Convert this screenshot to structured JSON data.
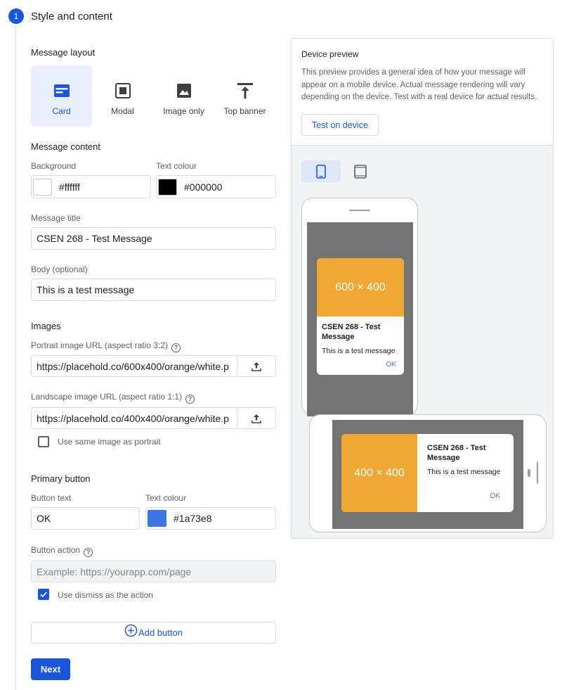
{
  "step": {
    "number": "1",
    "title": "Style and content"
  },
  "message_layout": {
    "label": "Message layout",
    "options": [
      {
        "label": "Card",
        "icon": "card-layout-icon",
        "selected": true
      },
      {
        "label": "Modal",
        "icon": "modal-layout-icon",
        "selected": false
      },
      {
        "label": "Image only",
        "icon": "image-icon",
        "selected": false
      },
      {
        "label": "Top banner",
        "icon": "top-banner-icon",
        "selected": false
      }
    ]
  },
  "message_content": {
    "label": "Message content",
    "background_label": "Background",
    "background_value": "#ffffff",
    "background_swatch": "#ffffff",
    "text_colour_label": "Text colour",
    "text_colour_value": "#000000",
    "text_colour_swatch": "#000000",
    "title_label": "Message title",
    "title_value": "CSEN 268 - Test Message",
    "body_label": "Body (optional)",
    "body_value": "This is a test message"
  },
  "images": {
    "label": "Images",
    "portrait_label": "Portrait image URL (aspect ratio 3:2)",
    "portrait_value": "https://placehold.co/600x400/orange/white.p",
    "landscape_label": "Landscape image URL (aspect ratio 1:1)",
    "landscape_value": "https://placehold.co/400x400/orange/white.p",
    "same_as_portrait_label": "Use same image as portrait",
    "same_as_portrait_checked": false
  },
  "primary_button": {
    "label": "Primary button",
    "button_text_label": "Button text",
    "button_text_value": "OK",
    "text_colour_label": "Text colour",
    "text_colour_value": "#1a73e8",
    "text_colour_swatch": "#3b76e3",
    "action_label": "Button action",
    "action_placeholder": "Example: https://yourapp.com/page",
    "dismiss_label": "Use dismiss as the action",
    "dismiss_checked": true
  },
  "add_button_label": "Add button",
  "next_label": "Next",
  "preview": {
    "title": "Device preview",
    "description": "This preview provides a general idea of how your message will appear on a mobile device. Actual message rendering will vary depending on the device. Test with a real device for actual results.",
    "test_button": "Test on device",
    "portrait_card": {
      "image_text": "600 × 400",
      "title": "CSEN 268 - Test Message",
      "body": "This is a test message",
      "ok": "OK"
    },
    "landscape_card": {
      "image_text": "400 × 400",
      "title": "CSEN 268 - Test Message",
      "body": "This is a test message",
      "ok": "OK"
    }
  },
  "colors": {
    "accent": "#1a56db",
    "image_placeholder": "#f0a733",
    "device_screen": "#737373"
  }
}
